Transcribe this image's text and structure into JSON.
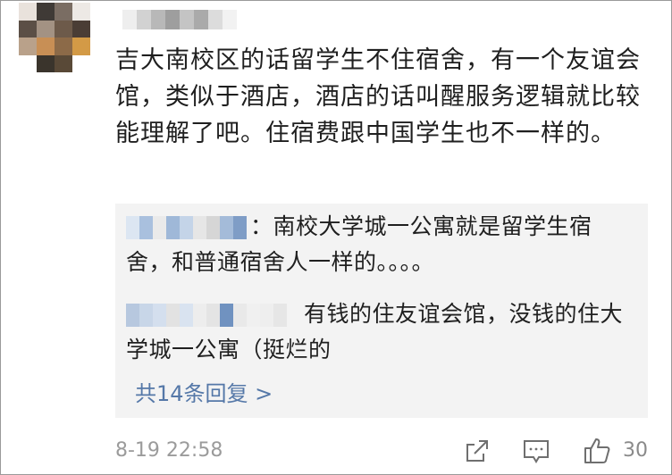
{
  "comment": {
    "text": "吉大南校区的话留学生不住宿舍，有一个友谊会馆，类似于酒店，酒店的话叫醒服务逻辑就比较能理解了吧。住宿费跟中国学生也不一样的。"
  },
  "replies": [
    {
      "text": "：南校大学城一公寓就是留学生宿舍，和普通宿舍人一样的。。。。"
    },
    {
      "text": "有钱的住友谊会馆，没钱的住大学城一公寓（挺烂的"
    }
  ],
  "more_replies_label": "共14条回复 >",
  "footer": {
    "timestamp": "8-19 22:58",
    "like_count": "30",
    "share_icon": "share-icon",
    "comment_icon": "comment-icon",
    "like_icon": "thumbs-up-icon"
  },
  "colors": {
    "link": "#5578a8",
    "reply_background": "#f3f3f3",
    "meta_text": "#9b9b9b"
  }
}
